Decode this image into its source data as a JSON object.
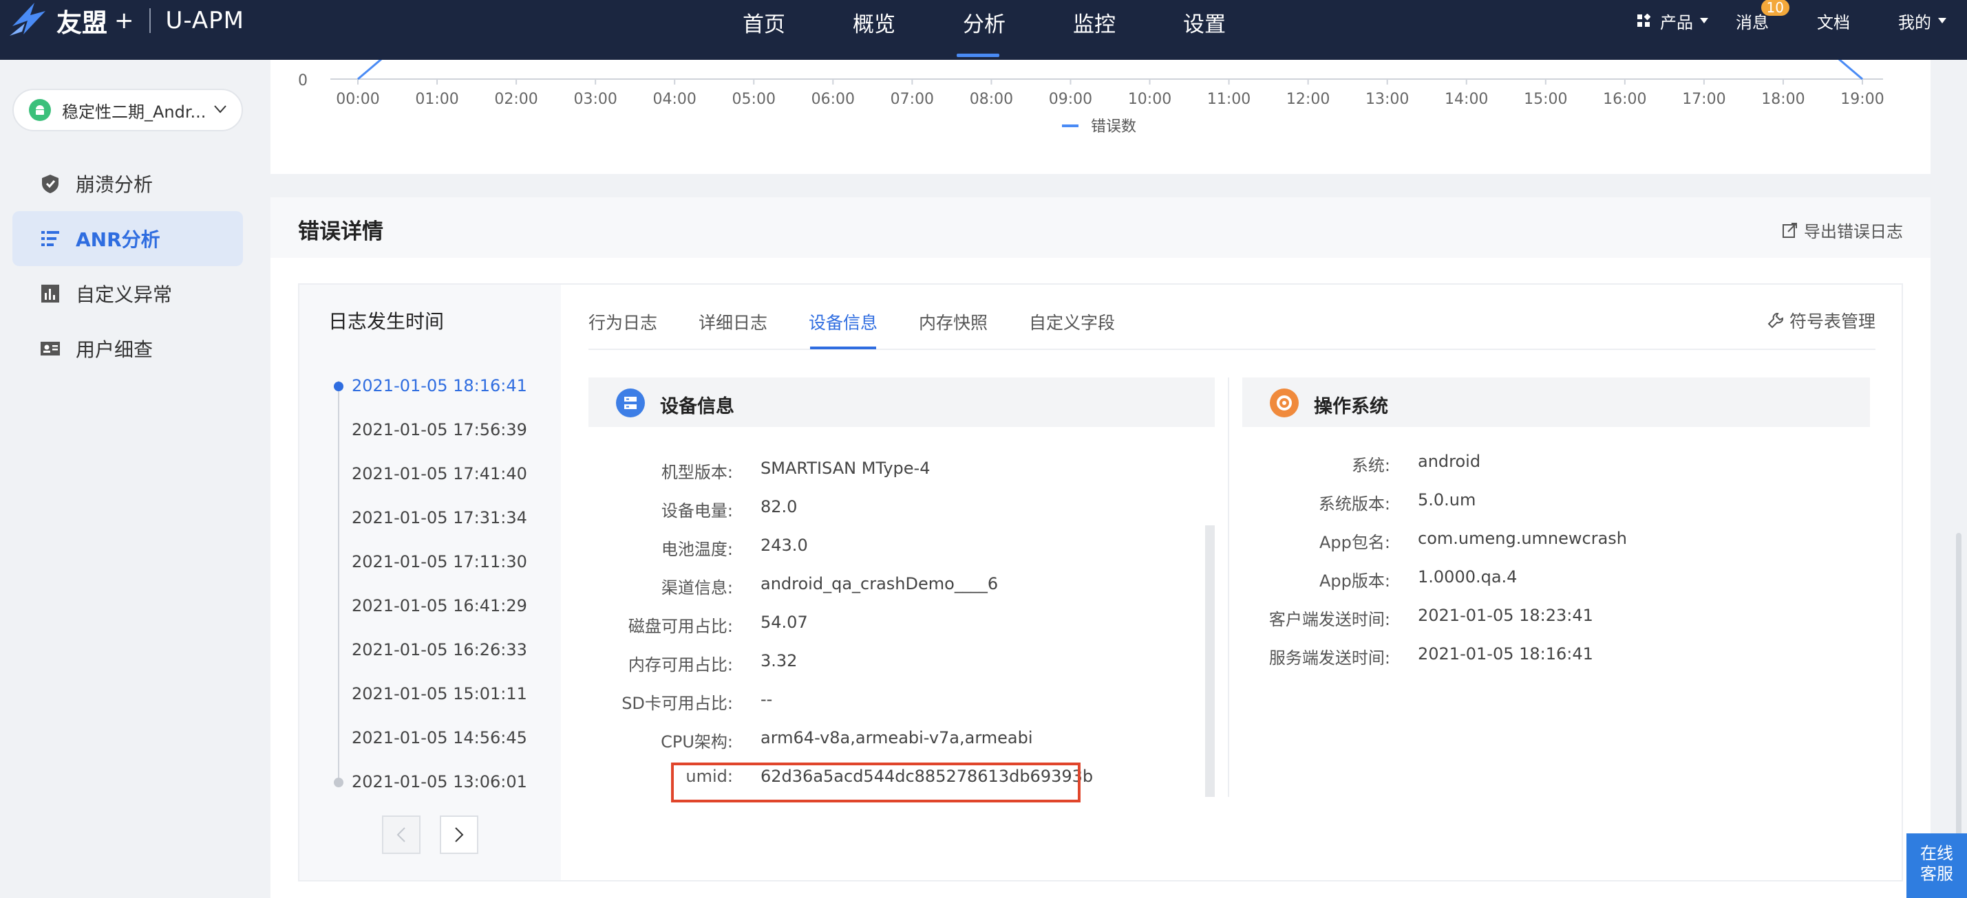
{
  "brand": {
    "name": "友盟",
    "plus": "+",
    "product": "U-APM"
  },
  "nav": {
    "items": [
      {
        "label": "首页",
        "active": false
      },
      {
        "label": "概览",
        "active": false
      },
      {
        "label": "分析",
        "active": true
      },
      {
        "label": "监控",
        "active": false
      },
      {
        "label": "设置",
        "active": false
      }
    ],
    "right": {
      "product": "产品",
      "messages": "消息",
      "message_badge": "10",
      "docs": "文档",
      "me": "我的"
    }
  },
  "sidebar": {
    "app_name": "稳定性二期_Andr...",
    "items": [
      {
        "label": "崩溃分析",
        "icon": "shield-icon",
        "active": false
      },
      {
        "label": "ANR分析",
        "icon": "list-icon",
        "active": true
      },
      {
        "label": "自定义异常",
        "icon": "bar-chart-icon",
        "active": false
      },
      {
        "label": "用户细查",
        "icon": "id-card-icon",
        "active": false
      }
    ]
  },
  "chart_data": {
    "type": "line",
    "x": [
      "00:00",
      "01:00",
      "02:00",
      "03:00",
      "04:00",
      "05:00",
      "06:00",
      "07:00",
      "08:00",
      "09:00",
      "10:00",
      "11:00",
      "12:00",
      "13:00",
      "14:00",
      "15:00",
      "16:00",
      "17:00",
      "18:00",
      "19:00"
    ],
    "y_tick_visible": "0",
    "series": [
      {
        "name": "错误数",
        "color": "#4a8bf5"
      }
    ],
    "legend": "bottom-center"
  },
  "detail": {
    "title": "错误详情",
    "export_label": "导出错误日志",
    "log_time_title": "日志发生时间",
    "timeline": [
      "2021-01-05 18:16:41",
      "2021-01-05 17:56:39",
      "2021-01-05 17:41:40",
      "2021-01-05 17:31:34",
      "2021-01-05 17:11:30",
      "2021-01-05 16:41:29",
      "2021-01-05 16:26:33",
      "2021-01-05 15:01:11",
      "2021-01-05 14:56:45",
      "2021-01-05 13:06:01"
    ],
    "tabs": [
      "行为日志",
      "详细日志",
      "设备信息",
      "内存快照",
      "自定义字段"
    ],
    "active_tab": "设备信息",
    "symbol_label": "符号表管理",
    "device": {
      "title": "设备信息",
      "fields": [
        {
          "k": "机型版本:",
          "v": "SMARTISAN MType-4"
        },
        {
          "k": "设备电量:",
          "v": "82.0"
        },
        {
          "k": "电池温度:",
          "v": "243.0"
        },
        {
          "k": "渠道信息:",
          "v": "android_qa_crashDemo____6"
        },
        {
          "k": "磁盘可用占比:",
          "v": "54.07"
        },
        {
          "k": "内存可用占比:",
          "v": "3.32"
        },
        {
          "k": "SD卡可用占比:",
          "v": "--"
        },
        {
          "k": "CPU架构:",
          "v": "arm64-v8a,armeabi-v7a,armeabi"
        },
        {
          "k": "umid:",
          "v": "62d36a5acd544dc885278613db69393b"
        }
      ]
    },
    "os": {
      "title": "操作系统",
      "fields": [
        {
          "k": "系统:",
          "v": "android"
        },
        {
          "k": "系统版本:",
          "v": "5.0.um"
        },
        {
          "k": "App包名:",
          "v": "com.umeng.umnewcrash"
        },
        {
          "k": "App版本:",
          "v": "1.0000.qa.4"
        },
        {
          "k": "客户端发送时间:",
          "v": "2021-01-05 18:23:41"
        },
        {
          "k": "服务端发送时间:",
          "v": "2021-01-05 18:16:41"
        }
      ]
    }
  },
  "service": {
    "line1": "在线",
    "line2": "客服"
  },
  "colors": {
    "nav_bg": "#1b2640",
    "accent": "#2f6de0",
    "highlight": "#e0452b",
    "os_icon": "#f08a3c",
    "device_icon": "#3d7ee6"
  }
}
